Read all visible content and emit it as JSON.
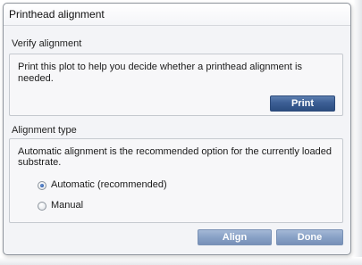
{
  "window": {
    "title": "Printhead alignment"
  },
  "verify": {
    "heading": "Verify alignment",
    "description_line1": "Print this plot to help you decide whether a printhead alignment is",
    "description_line2": "needed.",
    "print_label": "Print"
  },
  "alignment": {
    "heading": "Alignment type",
    "description_line1": "Automatic alignment is the recommended option for the currently loaded",
    "description_line2": "substrate.",
    "options": [
      {
        "label": "Automatic (recommended)",
        "selected": true
      },
      {
        "label": "Manual",
        "selected": false
      }
    ]
  },
  "footer": {
    "align_label": "Align",
    "done_label": "Done"
  }
}
